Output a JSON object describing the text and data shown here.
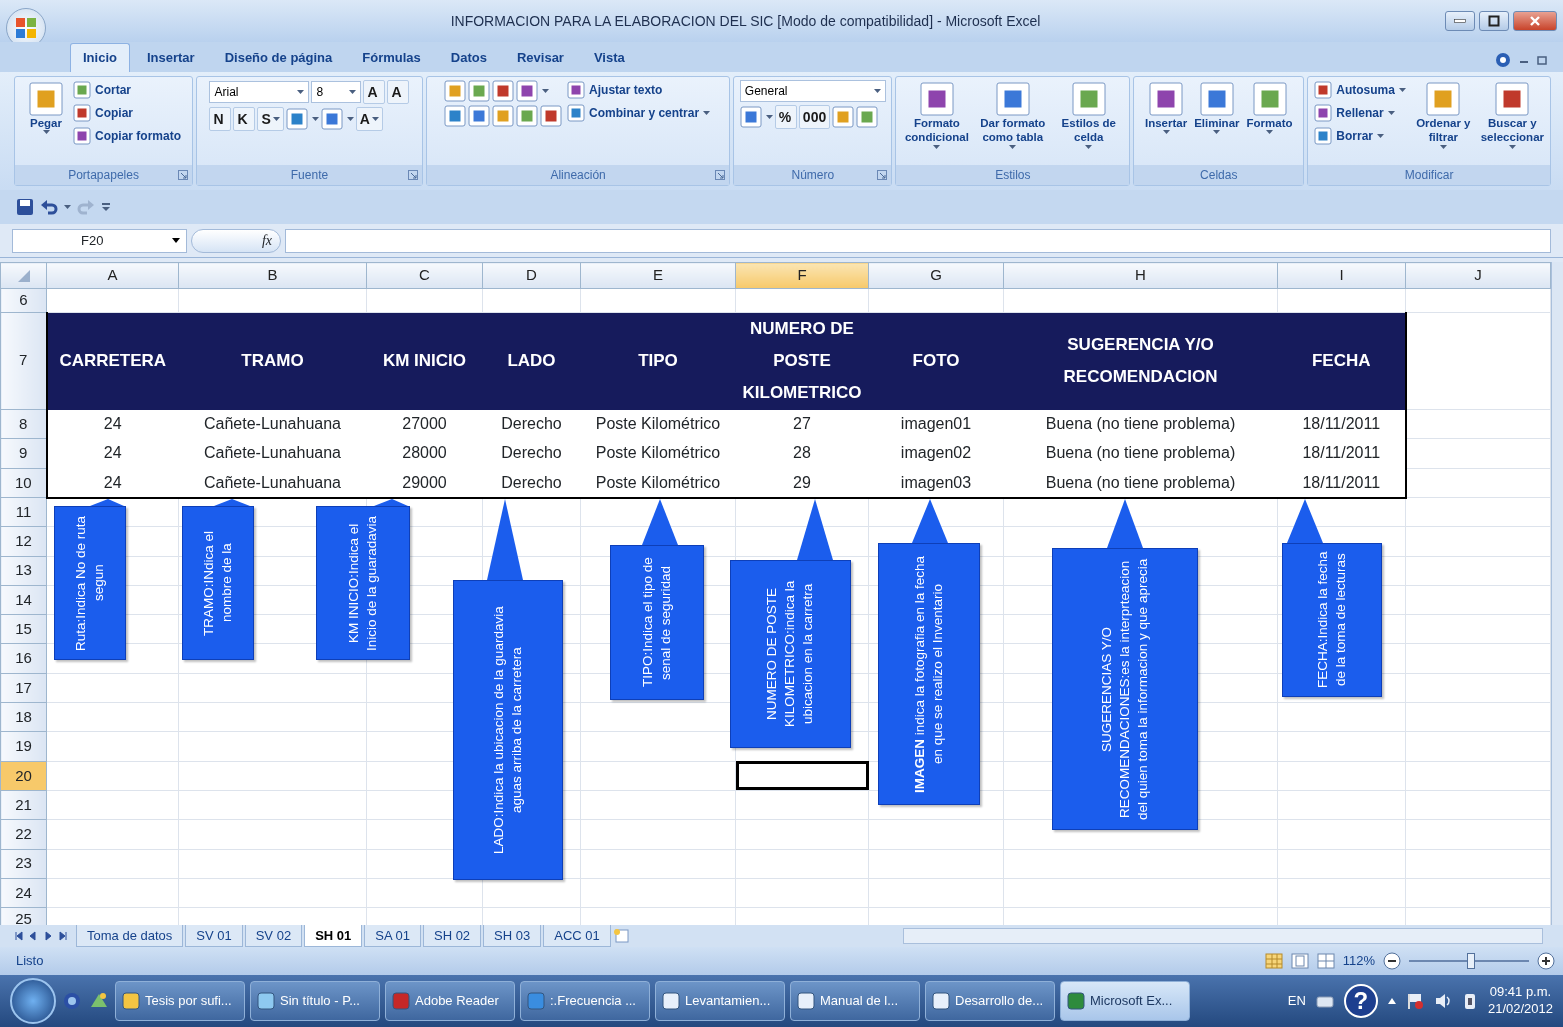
{
  "window": {
    "title": "INFORMACION PARA LA ELABORACION DEL SIC  [Modo de compatibilidad] - Microsoft Excel"
  },
  "ribbon": {
    "tabs": [
      {
        "label": "Inicio",
        "selected": true
      },
      {
        "label": "Insertar",
        "selected": false
      },
      {
        "label": "Diseño de página",
        "selected": false
      },
      {
        "label": "Fórmulas",
        "selected": false
      },
      {
        "label": "Datos",
        "selected": false
      },
      {
        "label": "Revisar",
        "selected": false
      },
      {
        "label": "Vista",
        "selected": false
      }
    ],
    "groups": [
      {
        "label": "Portapapeles",
        "launcher": true,
        "columns": [
          [
            [
              {
                "kind": "large",
                "label": "Pegar",
                "dropdown": true
              }
            ]
          ],
          [
            [
              {
                "kind": "small",
                "label": "Cortar"
              }
            ],
            [
              {
                "kind": "small",
                "label": "Copiar"
              }
            ],
            [
              {
                "kind": "small",
                "label": "Copiar formato"
              }
            ]
          ]
        ]
      },
      {
        "label": "Fuente",
        "launcher": true,
        "columns": [
          [
            [
              {
                "kind": "field",
                "value": "Arial"
              },
              {
                "kind": "field",
                "value": "8"
              },
              {
                "kind": "glyph",
                "label": "A"
              },
              {
                "kind": "glyph",
                "label": "A"
              }
            ],
            [
              {
                "kind": "glyph",
                "label": "N"
              },
              {
                "kind": "glyph",
                "label": "K"
              },
              {
                "kind": "glyph",
                "label": "S",
                "dropdown": true
              },
              {
                "kind": "icon",
                "dropdown": true
              },
              {
                "kind": "icon",
                "dropdown": true
              },
              {
                "kind": "glyph",
                "label": "A",
                "dropdown": true
              }
            ]
          ]
        ]
      },
      {
        "label": "Alineación",
        "launcher": true,
        "columns": [
          [
            [
              {
                "kind": "icon"
              },
              {
                "kind": "icon"
              },
              {
                "kind": "icon"
              },
              {
                "kind": "icon",
                "dropdown": true
              }
            ],
            [
              {
                "kind": "icon"
              },
              {
                "kind": "icon"
              },
              {
                "kind": "icon"
              },
              {
                "kind": "icon"
              },
              {
                "kind": "icon"
              }
            ]
          ],
          [
            [
              {
                "kind": "small",
                "label": "Ajustar texto"
              }
            ],
            [
              {
                "kind": "small",
                "label": "Combinar y centrar",
                "dropdown": true
              }
            ]
          ]
        ]
      },
      {
        "label": "Número",
        "launcher": true,
        "columns": [
          [
            [
              {
                "kind": "field",
                "value": "General"
              }
            ],
            [
              {
                "kind": "icon",
                "dropdown": true
              },
              {
                "kind": "glyph",
                "label": "%"
              },
              {
                "kind": "glyph",
                "label": "000"
              },
              {
                "kind": "icon"
              },
              {
                "kind": "icon"
              }
            ]
          ]
        ]
      },
      {
        "label": "Estilos",
        "columns": [
          [
            [
              {
                "kind": "large",
                "label": "Formato condicional",
                "dropdown": true
              }
            ]
          ],
          [
            [
              {
                "kind": "large",
                "label": "Dar formato como tabla",
                "dropdown": true
              }
            ]
          ],
          [
            [
              {
                "kind": "large",
                "label": "Estilos de celda",
                "dropdown": true
              }
            ]
          ]
        ]
      },
      {
        "label": "Celdas",
        "columns": [
          [
            [
              {
                "kind": "large",
                "label": "Insertar",
                "dropdown": true
              }
            ]
          ],
          [
            [
              {
                "kind": "large",
                "label": "Eliminar",
                "dropdown": true
              }
            ]
          ],
          [
            [
              {
                "kind": "large",
                "label": "Formato",
                "dropdown": true
              }
            ]
          ]
        ]
      },
      {
        "label": "Modificar",
        "columns": [
          [
            [
              {
                "kind": "small",
                "label": "Autosuma",
                "dropdown": true
              }
            ],
            [
              {
                "kind": "small",
                "label": "Rellenar",
                "dropdown": true
              }
            ],
            [
              {
                "kind": "small",
                "label": "Borrar",
                "dropdown": true
              }
            ]
          ],
          [
            [
              {
                "kind": "large",
                "label": "Ordenar y filtrar",
                "dropdown": true
              }
            ]
          ],
          [
            [
              {
                "kind": "large",
                "label": "Buscar y seleccionar",
                "dropdown": true
              }
            ]
          ]
        ]
      }
    ]
  },
  "formula_bar": {
    "name_box": "F20",
    "fx": "fx"
  },
  "sheet": {
    "columns": [
      {
        "label": "A",
        "selected": false
      },
      {
        "label": "B",
        "selected": false
      },
      {
        "label": "C",
        "selected": false
      },
      {
        "label": "D",
        "selected": false
      },
      {
        "label": "E",
        "selected": false
      },
      {
        "label": "F",
        "selected": true
      },
      {
        "label": "G",
        "selected": false
      },
      {
        "label": "H",
        "selected": false
      },
      {
        "label": "I",
        "selected": false
      },
      {
        "label": "J",
        "selected": false
      }
    ],
    "rows": [
      {
        "label": "6",
        "selected": false,
        "kind": "blank"
      },
      {
        "label": "7",
        "selected": false,
        "kind": "header",
        "cells": [
          "CARRETERA",
          "TRAMO",
          "KM INICIO",
          "LADO",
          "TIPO",
          "NUMERO DE POSTE KILOMETRICO",
          "FOTO",
          "SUGERENCIA Y/O RECOMENDACION",
          "FECHA"
        ]
      },
      {
        "label": "8",
        "selected": false,
        "kind": "record",
        "cells": [
          "24",
          "Cañete-Lunahuana",
          "27000",
          "Derecho",
          "Poste Kilométrico",
          "27",
          "imagen01",
          "Buena (no tiene problema)",
          "18/11/2011"
        ]
      },
      {
        "label": "9",
        "selected": false,
        "kind": "record",
        "cells": [
          "24",
          "Cañete-Lunahuana",
          "28000",
          "Derecho",
          "Poste Kilométrico",
          "28",
          "imagen02",
          "Buena (no tiene problema)",
          "18/11/2011"
        ]
      },
      {
        "label": "10",
        "selected": false,
        "kind": "record",
        "cells": [
          "24",
          "Cañete-Lunahuana",
          "29000",
          "Derecho",
          "Poste Kilométrico",
          "29",
          "imagen03",
          "Buena (no tiene problema)",
          "18/11/2011"
        ]
      },
      {
        "label": "11",
        "selected": false,
        "kind": "blank"
      },
      {
        "label": "12",
        "selected": false,
        "kind": "blank"
      },
      {
        "label": "13",
        "selected": false,
        "kind": "blank"
      },
      {
        "label": "14",
        "selected": false,
        "kind": "blank"
      },
      {
        "label": "15",
        "selected": false,
        "kind": "blank"
      },
      {
        "label": "16",
        "selected": false,
        "kind": "blank"
      },
      {
        "label": "17",
        "selected": false,
        "kind": "blank"
      },
      {
        "label": "18",
        "selected": false,
        "kind": "blank"
      },
      {
        "label": "19",
        "selected": false,
        "kind": "blank"
      },
      {
        "label": "20",
        "selected": true,
        "kind": "blank"
      },
      {
        "label": "21",
        "selected": false,
        "kind": "blank"
      },
      {
        "label": "22",
        "selected": false,
        "kind": "blank"
      },
      {
        "label": "23",
        "selected": false,
        "kind": "blank"
      },
      {
        "label": "24",
        "selected": false,
        "kind": "blank"
      },
      {
        "label": "25",
        "selected": false,
        "kind": "blank"
      }
    ],
    "callouts": [
      {
        "text": "Ruta:Indica No de ruta segun"
      },
      {
        "text": "TRAMO:INdica el nombre de la"
      },
      {
        "text": "KM INICIO:Indica el Inicio de la guaradavia"
      },
      {
        "text": "LADO:Indica la ubicacion de la guardavia aguas arriba de la carretera"
      },
      {
        "text": "TIPO:Indica el tipo de senal de seguridad"
      },
      {
        "text": "NUMERO DE POSTE KILOMETRICO:indica la ubicacion en la carretra"
      },
      {
        "text": "**IMAGEN** indica la fotografia en la fecha en que se realizo el Inventario"
      },
      {
        "text": "SUGERENCIAS Y/O RECOMENDACIONES:es la interprteacion del quien toma la informacion y que aprecia"
      },
      {
        "text": "FECHA:Indica la fecha de la toma de lecturas"
      }
    ]
  },
  "sheet_tabs": [
    {
      "label": "Toma de datos",
      "selected": false
    },
    {
      "label": "SV 01",
      "selected": false
    },
    {
      "label": "SV 02",
      "selected": false
    },
    {
      "label": "SH 01",
      "selected": true
    },
    {
      "label": "SA 01",
      "selected": false
    },
    {
      "label": "SH 02",
      "selected": false
    },
    {
      "label": "SH 03",
      "selected": false
    },
    {
      "label": "ACC 01",
      "selected": false
    }
  ],
  "status_bar": {
    "text": "Listo",
    "zoom": "112%",
    "zoom_slider": {
      "level": 0.52
    }
  },
  "taskbar": {
    "tasks": [
      {
        "label": "Tesis por sufi...",
        "selected": false
      },
      {
        "label": "Sin título - P...",
        "selected": false
      },
      {
        "label": "Adobe Reader",
        "selected": false
      },
      {
        "label": ":.Frecuencia ...",
        "selected": false
      },
      {
        "label": "Levantamien...",
        "selected": false
      },
      {
        "label": "Manual de l...",
        "selected": false
      },
      {
        "label": "Desarrollo de...",
        "selected": false
      },
      {
        "label": "Microsoft Ex...",
        "selected": true
      }
    ],
    "language": "EN",
    "help": "?",
    "time": "09:41 p.m.",
    "date": "21/02/2012"
  }
}
